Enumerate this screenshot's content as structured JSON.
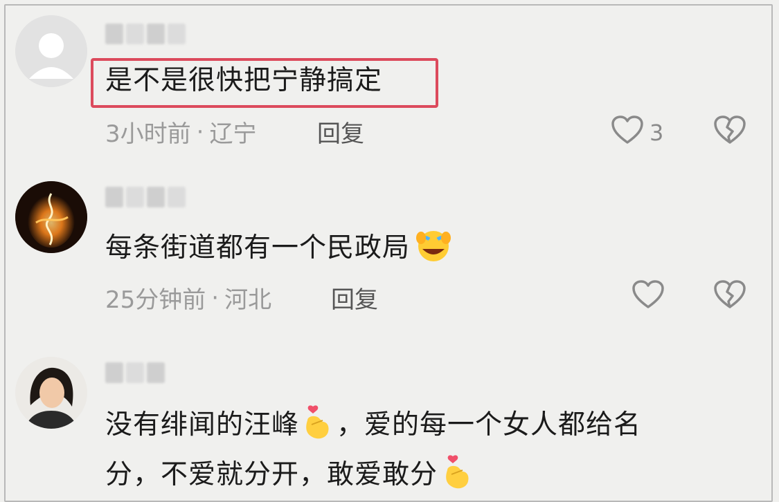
{
  "comments": [
    {
      "avatar_icon": "default-user-avatar-icon",
      "text": "是不是很快把宁静搞定",
      "time": "3小时前",
      "separator": "·",
      "location": "辽宁",
      "reply_label": "回复",
      "like_count": "3",
      "highlighted": true
    },
    {
      "avatar_icon": "fire-avatar-icon",
      "text": "每条街道都有一个民政局",
      "emoji": "laughing-crying-emoji",
      "time": "25分钟前",
      "separator": "·",
      "location": "河北",
      "reply_label": "回复",
      "like_count": ""
    },
    {
      "avatar_icon": "woman-photo-avatar-icon",
      "text_line1": "没有绯闻的汪峰",
      "text_line1b": "，爱的每一个女人都给名",
      "text_line2": "分，不爱就分开，敢爱敢分",
      "emoji": "finger-heart-emoji"
    }
  ],
  "colors": {
    "highlight_border": "#dc4a5c",
    "meta_text": "#9a9a9a",
    "body_text": "#1b1b1b"
  }
}
